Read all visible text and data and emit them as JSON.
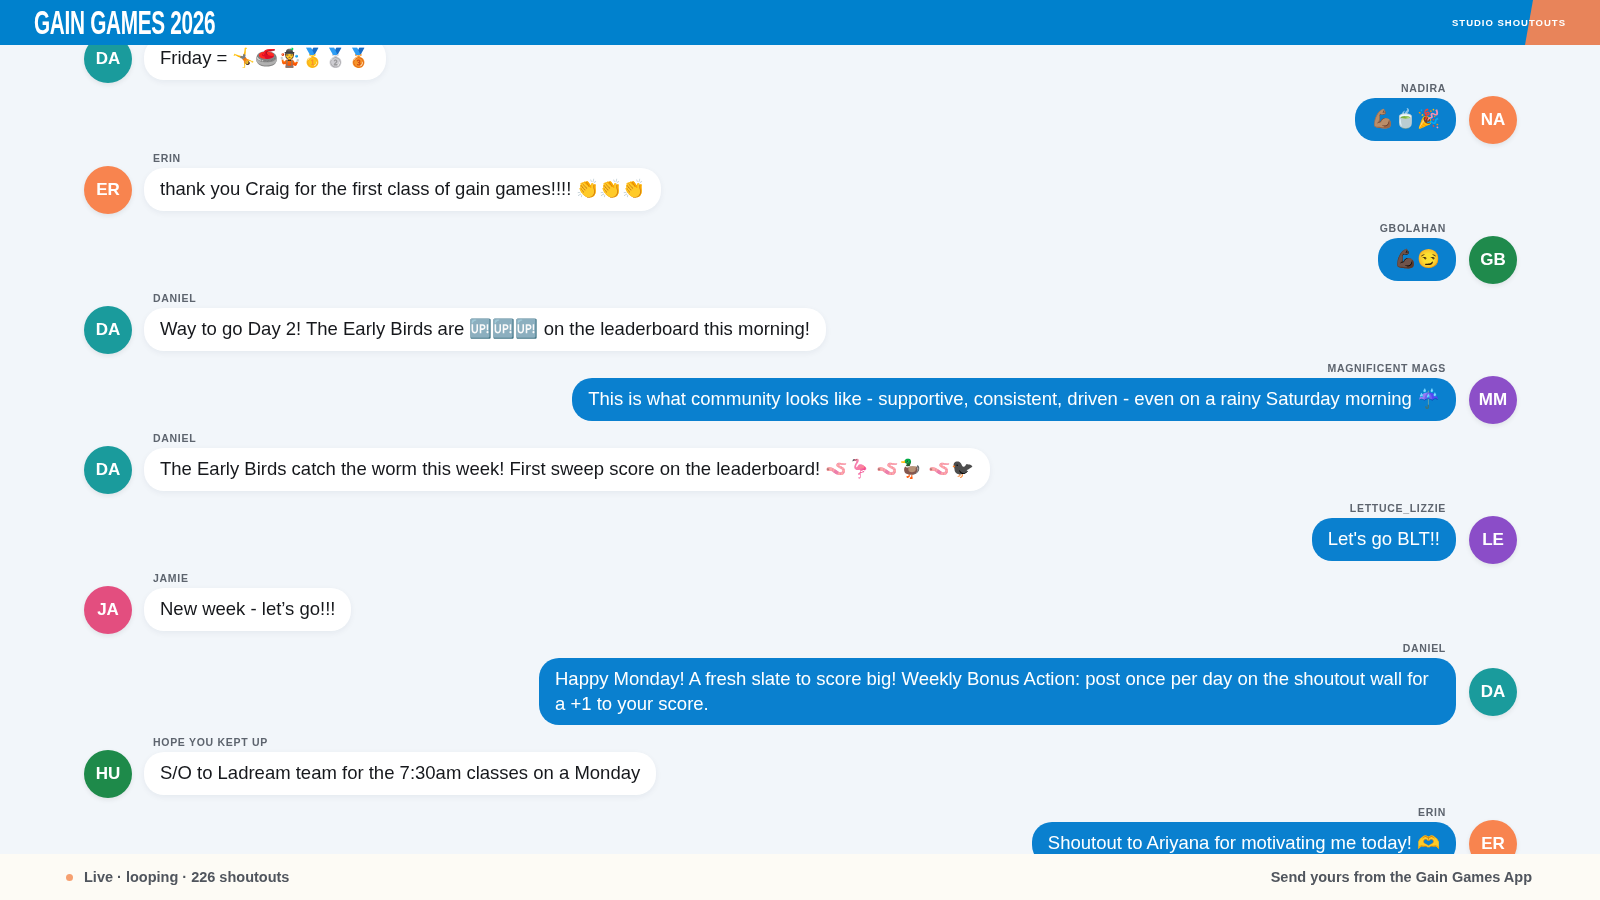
{
  "header": {
    "title": "GAIN GAMES 2026",
    "label": "STUDIO SHOUTOUTS"
  },
  "messages": [
    {
      "outgoing": false,
      "initials": "DA",
      "color": "#1a9b9c",
      "text": "Friday = 🤸🥌🤹🥇🥈🥉"
    },
    {
      "outgoing": true,
      "author": "NADIRA",
      "initials": "NA",
      "color": "#f8844f",
      "text": "💪🏽🍵🎉"
    },
    {
      "outgoing": false,
      "author": "ERIN",
      "initials": "ER",
      "color": "#f8844f",
      "text": "thank you Craig for the first class of gain games!!!! 👏👏👏"
    },
    {
      "outgoing": true,
      "author": "GBOLAHAN",
      "initials": "GB",
      "color": "#1f8a4c",
      "text": "💪🏿😏"
    },
    {
      "outgoing": false,
      "author": "DANIEL",
      "initials": "DA",
      "color": "#1a9b9c",
      "text": "Way to go Day 2! The Early Birds are 🆙🆙🆙 on the leaderboard this morning!"
    },
    {
      "outgoing": true,
      "author": "MAGNIFICENT MAGS",
      "initials": "MM",
      "color": "#8c4fc8",
      "text": "This is what community looks like - supportive, consistent, driven - even on a rainy Saturday morning ☔"
    },
    {
      "outgoing": false,
      "author": "DANIEL",
      "initials": "DA",
      "color": "#1a9b9c",
      "text": "The Early Birds catch the worm this week! First sweep score on the leaderboard! 🪱🦩 🪱🦆 🪱🐦‍⬛"
    },
    {
      "outgoing": true,
      "author": "LETTUCE_LIZZIE",
      "initials": "LE",
      "color": "#8b4dc8",
      "text": "Let's go BLT!!"
    },
    {
      "outgoing": false,
      "author": "JAMIE",
      "initials": "JA",
      "color": "#e34e7f",
      "text": "New week - let’s go!!!"
    },
    {
      "outgoing": true,
      "author": "DANIEL",
      "initials": "DA",
      "color": "#1a9b9c",
      "text": "Happy Monday! A fresh slate to score big! Weekly Bonus Action: post once per day on the shoutout wall for a +1 to your score."
    },
    {
      "outgoing": false,
      "author": "HOPE YOU KEPT UP",
      "initials": "HU",
      "color": "#1e8a4a",
      "text": "S/O to Ladream team for the 7:30am classes on a Monday"
    },
    {
      "outgoing": true,
      "author": "ERIN",
      "initials": "ER",
      "color": "#f8844f",
      "text": "Shoutout to Ariyana for motivating me today! 🫶"
    }
  ],
  "footer": {
    "status": "Live · looping · 226 shoutouts",
    "cta": "Send yours from the Gain Games App"
  }
}
